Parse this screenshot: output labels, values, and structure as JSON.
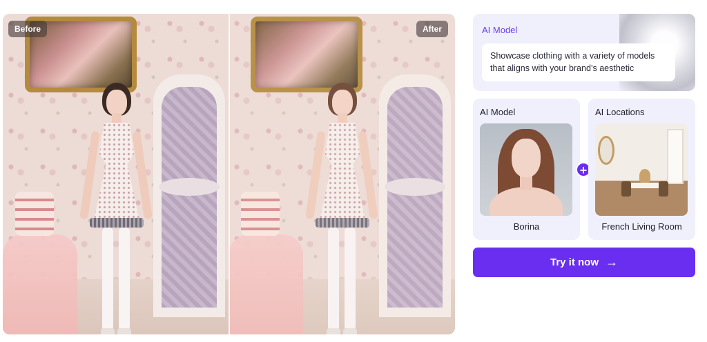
{
  "compare": {
    "before_label": "Before",
    "after_label": "After"
  },
  "feature": {
    "title": "AI Model",
    "description": "Showcase clothing with a variety of models that aligns with your brand’s aesthetic"
  },
  "model_card": {
    "label": "AI Model",
    "name": "Borina"
  },
  "location_card": {
    "label": "AI Locations",
    "name": "French Living Room"
  },
  "combine_symbol": "+",
  "cta": {
    "label": "Try it now",
    "arrow": "→"
  },
  "colors": {
    "accent": "#6a2ef0",
    "card_bg": "#eff0fb",
    "title_color": "#6c3df0"
  }
}
